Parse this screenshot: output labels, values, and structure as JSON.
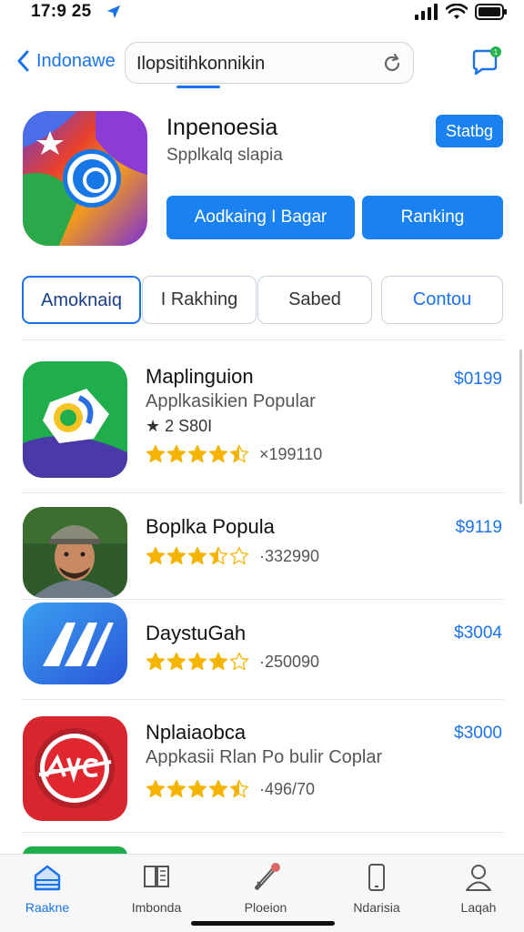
{
  "status": {
    "time": "17:9 25"
  },
  "nav": {
    "back_label": "Indonawe",
    "search_value": "Ilopsitihkonnikin"
  },
  "hero": {
    "title": "Inpenoesia",
    "subtitle": "Spplkalq slapia",
    "status_button": "Statbg",
    "apps_button": "Aodkaing I Bagar",
    "rank_button": "Ranking"
  },
  "segments": [
    {
      "label": "Amoknaiq"
    },
    {
      "label": "I Rakhing"
    },
    {
      "label": "Sabed"
    },
    {
      "label": "Contou"
    }
  ],
  "apps": [
    {
      "name": "Maplinguion",
      "subtitle": "Applkasikien Popular",
      "badge": "★ 2 S80I",
      "price": "$0199",
      "rating": 4.5,
      "reviews": "×199110"
    },
    {
      "name": "Boplka Popula",
      "price": "$9119",
      "rating": 3.5,
      "reviews": "·332990"
    },
    {
      "name": "DaystuGah",
      "price": "$3004",
      "rating": 4,
      "reviews": "·250090"
    },
    {
      "name": "Nplaiaobca",
      "subtitle": "Appkasii Rlan Po bulir Coplar",
      "price": "$3000",
      "rating": 4.5,
      "reviews": "·496/70"
    }
  ],
  "tabs": [
    {
      "label": "Raakne"
    },
    {
      "label": "Imbonda"
    },
    {
      "label": "Ploeion"
    },
    {
      "label": "Ndarisia"
    },
    {
      "label": "Laqah"
    }
  ],
  "colors": {
    "accent": "#1a73e8",
    "button": "#1a82f0",
    "star": "#f5b400"
  }
}
